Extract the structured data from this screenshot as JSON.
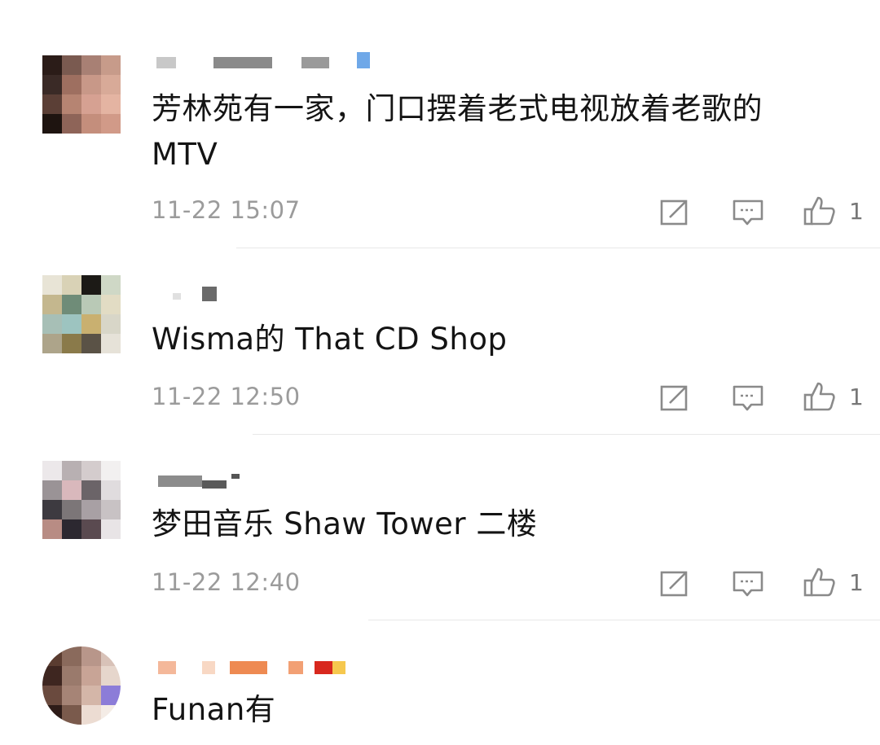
{
  "comments": [
    {
      "text": "芳林苑有一家，门口摆着老式电视放着老歌的\nMTV",
      "time": "11-22 15:07",
      "likes": "1",
      "avatar_colors": [
        "#2b1c18",
        "#7a5a50",
        "#a88074",
        "#c79b8a",
        "#3a2a26",
        "#9e6f60",
        "#c89888",
        "#d8aa98",
        "#5b3f36",
        "#b68472",
        "#d6a192",
        "#e4b4a2",
        "#1e1410",
        "#8e6458",
        "#c48e7c",
        "#d19a88"
      ]
    },
    {
      "text": "Wisma的 That CD Shop",
      "time": "11-22 12:50",
      "likes": "1",
      "avatar_colors": [
        "#e8e4d6",
        "#d9d2b6",
        "#1c1a16",
        "#cfd8c6",
        "#c4b78e",
        "#6f8c78",
        "#b9c9b6",
        "#e2dcc4",
        "#a7bfb6",
        "#9dc4c0",
        "#c9b070",
        "#d8d6c8",
        "#ada48a",
        "#8a7a4a",
        "#5a5246",
        "#e6e2d8"
      ]
    },
    {
      "text": "梦田音乐 Shaw Tower 二楼",
      "time": "11-22 12:40",
      "likes": "1",
      "avatar_colors": [
        "#ece8ea",
        "#b8b0b2",
        "#d4cccd",
        "#f2f0f0",
        "#9a9396",
        "#d9b8bc",
        "#6b6468",
        "#e0dcde",
        "#3d3a40",
        "#7c7678",
        "#a8a0a4",
        "#c8c2c4",
        "#b88c84",
        "#2c2830",
        "#5a4a50",
        "#e8e4e6"
      ]
    },
    {
      "text": "Funan有",
      "time": "",
      "likes": "",
      "avatar_colors": [
        "#5a3c30",
        "#8a6a5c",
        "#b8968a",
        "#d8c2b8",
        "#3e2620",
        "#9a7a6c",
        "#c8a496",
        "#e6d6cc",
        "#6a4a3e",
        "#a68476",
        "#d4b6a8",
        "#8c7cd8",
        "#2e1c18",
        "#7a5a4c",
        "#ecdcd2",
        "#f4ece6"
      ]
    }
  ],
  "actions": {
    "reply_icon": "edit-icon",
    "comment_icon": "comment-icon",
    "like_icon": "thumbs-up-icon"
  }
}
